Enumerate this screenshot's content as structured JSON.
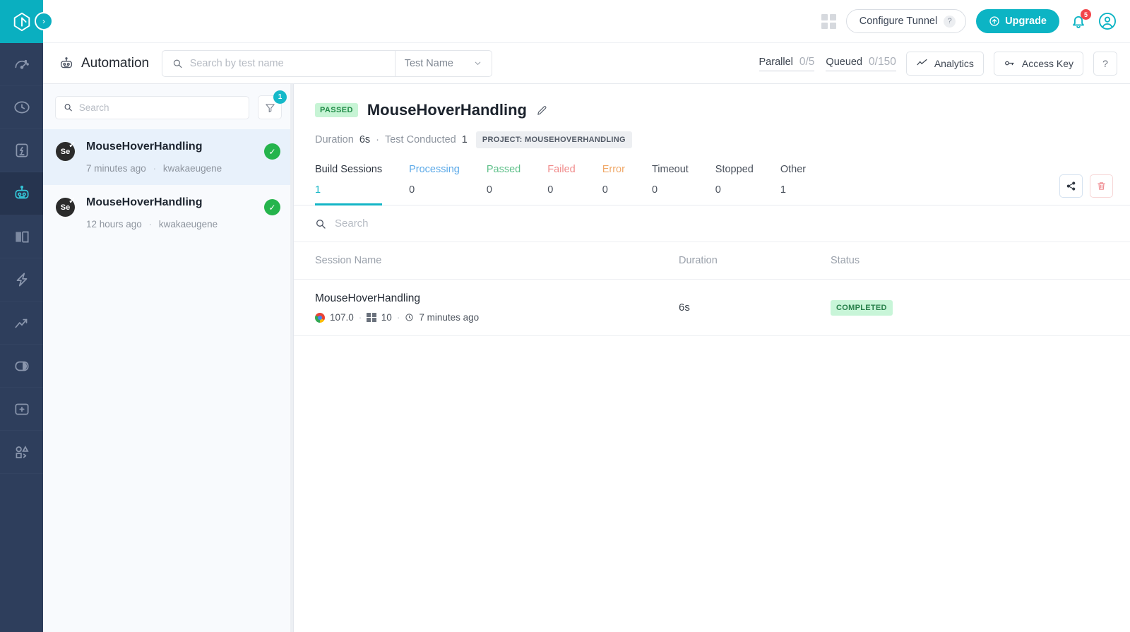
{
  "brand": {
    "accent": "#0cb4c4",
    "rail_bg": "#2e3e5c",
    "logo_icon": "lambdatest-logo-icon"
  },
  "topbar": {
    "apps_icon": "grid-apps-icon",
    "tunnel_label": "Configure Tunnel",
    "tunnel_help": "?",
    "upgrade_label": "Upgrade",
    "upgrade_icon": "arrow-up-circle-icon",
    "bell_icon": "notification-bell-icon",
    "bell_count": "5",
    "avatar_icon": "user-avatar-icon"
  },
  "rail": {
    "collapse_icon": "chevron-right-icon",
    "items": [
      {
        "name": "dashboard",
        "icon": "speedometer-icon",
        "active": false
      },
      {
        "name": "real-time",
        "icon": "clock-arrow-icon",
        "active": false
      },
      {
        "name": "hyperexecute",
        "icon": "lightning-box-icon",
        "active": false
      },
      {
        "name": "automation",
        "icon": "robot-icon",
        "active": true
      },
      {
        "name": "smart-ui",
        "icon": "compare-pages-icon",
        "active": false
      },
      {
        "name": "test-at-scale",
        "icon": "bolt-icon",
        "active": false
      },
      {
        "name": "analytics",
        "icon": "trend-chart-icon",
        "active": false
      },
      {
        "name": "visual-regression",
        "icon": "contrast-icon",
        "active": false
      },
      {
        "name": "add-integration",
        "icon": "plus-box-icon",
        "active": false
      },
      {
        "name": "developer-tools",
        "icon": "shapes-code-icon",
        "active": false
      }
    ]
  },
  "subbar": {
    "page_icon": "robot-icon",
    "page_title": "Automation",
    "search_placeholder": "Search by test name",
    "search_value": "",
    "search_icon": "search-icon",
    "filter_select": "Test Name",
    "filter_select_icon": "chevron-down-icon",
    "stats": [
      {
        "label": "Parallel",
        "value": "0/5"
      },
      {
        "label": "Queued",
        "value": "0/150"
      }
    ],
    "analytics_label": "Analytics",
    "analytics_icon": "line-chart-icon",
    "access_key_label": "Access Key",
    "access_key_icon": "key-icon",
    "help_label": "?"
  },
  "list_panel": {
    "search_placeholder": "Search",
    "search_value": "",
    "search_icon": "search-icon",
    "filter_icon": "funnel-icon",
    "filter_badge": "1",
    "items": [
      {
        "framework_badge": "Se",
        "name": "MouseHoverHandling",
        "time": "7 minutes ago",
        "separator": "·",
        "user": "kwakaeugene",
        "status_icon": "check-circle-icon",
        "selected": true
      },
      {
        "framework_badge": "Se",
        "name": "MouseHoverHandling",
        "time": "12 hours ago",
        "separator": "·",
        "user": "kwakaeugene",
        "status_icon": "check-circle-icon",
        "selected": false
      }
    ]
  },
  "detail": {
    "status_badge": "PASSED",
    "title": "MouseHoverHandling",
    "edit_icon": "pencil-icon",
    "duration_label": "Duration",
    "duration_value": "6s",
    "meta_separator": "·",
    "test_conducted_label": "Test Conducted",
    "test_conducted_value": "1",
    "project_chip": "PROJECT: MOUSEHOVERHANDLING",
    "tabs": [
      {
        "label": "Build Sessions",
        "count": "1",
        "active": true,
        "color": "#2e3540"
      },
      {
        "label": "Processing",
        "count": "0",
        "active": false,
        "color": "#5ba9e8"
      },
      {
        "label": "Passed",
        "count": "0",
        "active": false,
        "color": "#5fc08a"
      },
      {
        "label": "Failed",
        "count": "0",
        "active": false,
        "color": "#f08a8a"
      },
      {
        "label": "Error",
        "count": "0",
        "active": false,
        "color": "#f0a868"
      },
      {
        "label": "Timeout",
        "count": "0",
        "active": false,
        "color": "#4a515c"
      },
      {
        "label": "Stopped",
        "count": "0",
        "active": false,
        "color": "#4a515c"
      },
      {
        "label": "Other",
        "count": "1",
        "active": false,
        "color": "#4a515c"
      }
    ],
    "share_icon": "share-icon",
    "delete_icon": "trash-icon",
    "inner_search_placeholder": "Search",
    "inner_search_value": "",
    "inner_search_icon": "search-icon",
    "table": {
      "columns": [
        "Session Name",
        "Duration",
        "Status"
      ],
      "rows": [
        {
          "session_name": "MouseHoverHandling",
          "browser_icon": "chrome-icon",
          "browser_version": "107.0",
          "os_icon": "windows-icon",
          "os_version": "10",
          "time_icon": "clock-icon",
          "time": "7 minutes ago",
          "separator": "·",
          "duration": "6s",
          "status": "COMPLETED"
        }
      ]
    }
  }
}
